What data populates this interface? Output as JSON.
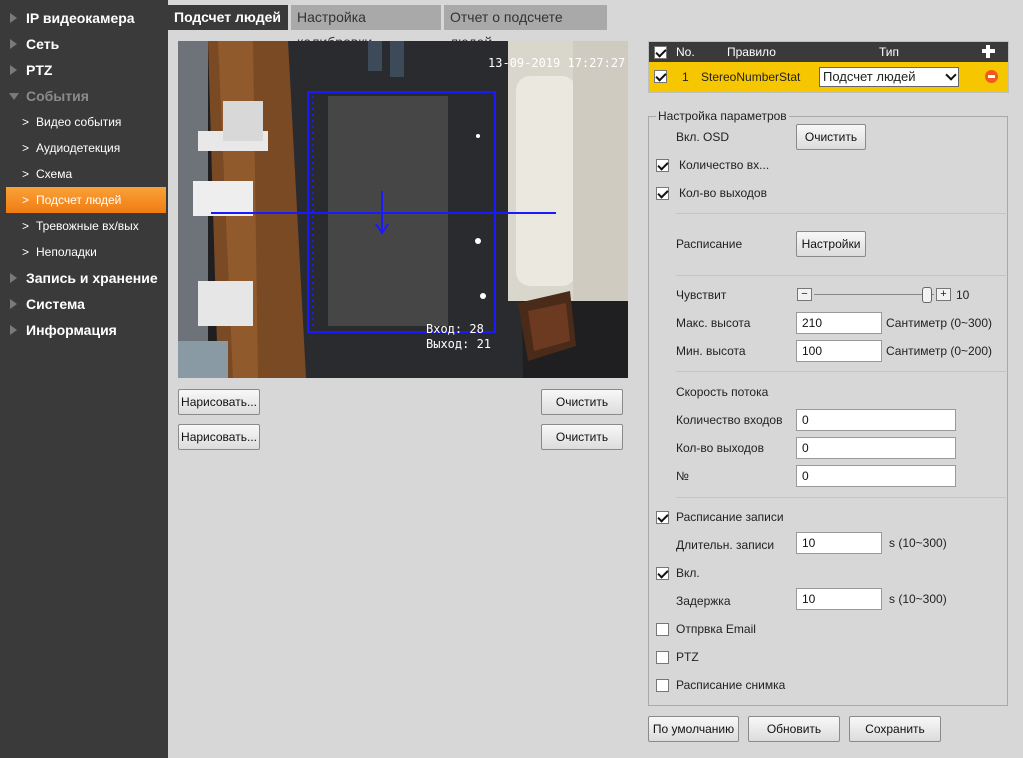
{
  "sidebar": {
    "ip_camera": "IP видеокамера",
    "network": "Сеть",
    "ptz": "PTZ",
    "events": "События",
    "sub": [
      "Видео события",
      "Аудиодетекция",
      "Схема",
      "Подсчет людей",
      "Тревожные вх/вых",
      "Неполадки"
    ],
    "storage": "Запись и хранение",
    "system": "Система",
    "info": "Информация"
  },
  "tabs": [
    "Подсчет людей",
    "Настройка калибровки",
    "Отчет о подсчете людей"
  ],
  "video": {
    "timestamp": "13-09-2019 17:27:27",
    "osd_in": "Вход: 28",
    "osd_out": "Выход: 21"
  },
  "buttons": {
    "draw": "Нарисовать...",
    "clear": "Очистить",
    "default": "По умолчанию",
    "refresh": "Обновить",
    "save": "Сохранить",
    "settings": "Настройки"
  },
  "rules": {
    "col_no": "No.",
    "col_rule": "Правило",
    "col_type": "Тип",
    "row_no": "1",
    "row_rule": "StereoNumberStat",
    "row_type": "Подсчет людей"
  },
  "params": {
    "legend": "Настройка параметров",
    "osd_label": "Вкл. OSD",
    "count_in": "Количество вх...",
    "count_out": "Кол-во выходов",
    "schedule": "Расписание",
    "sensitivity": "Чувствит",
    "sensitivity_value": "10",
    "sensitivity_fraction": 1.0,
    "max_height": "Макс. высота",
    "max_height_value": "210",
    "max_height_unit": "Сантиметр (0~300)",
    "min_height": "Мин. высота",
    "min_height_value": "100",
    "min_height_unit": "Сантиметр (0~200)",
    "flow_speed": "Скорость потока",
    "flow_in": "Количество входов",
    "flow_in_value": "0",
    "flow_out": "Кол-во выходов",
    "flow_out_value": "0",
    "flow_no": "№",
    "flow_no_value": "0",
    "record_schedule": "Расписание записи",
    "record_duration": "Длительн. записи",
    "record_duration_value": "10",
    "record_duration_unit": "s (10~300)",
    "enable": "Вкл.",
    "delay": "Задержка",
    "delay_value": "10",
    "delay_unit": "s (10~300)",
    "send_email": "Отпрвка Email",
    "ptz": "PTZ",
    "snapshot_schedule": "Расписание снимка"
  },
  "colors": {
    "sidebar_bg": "#3a3a3a",
    "active_item": "#f08a1e",
    "rule_row": "#f6c700",
    "page_bg": "#d7d7d7",
    "roi_line": "#1a1aff"
  }
}
